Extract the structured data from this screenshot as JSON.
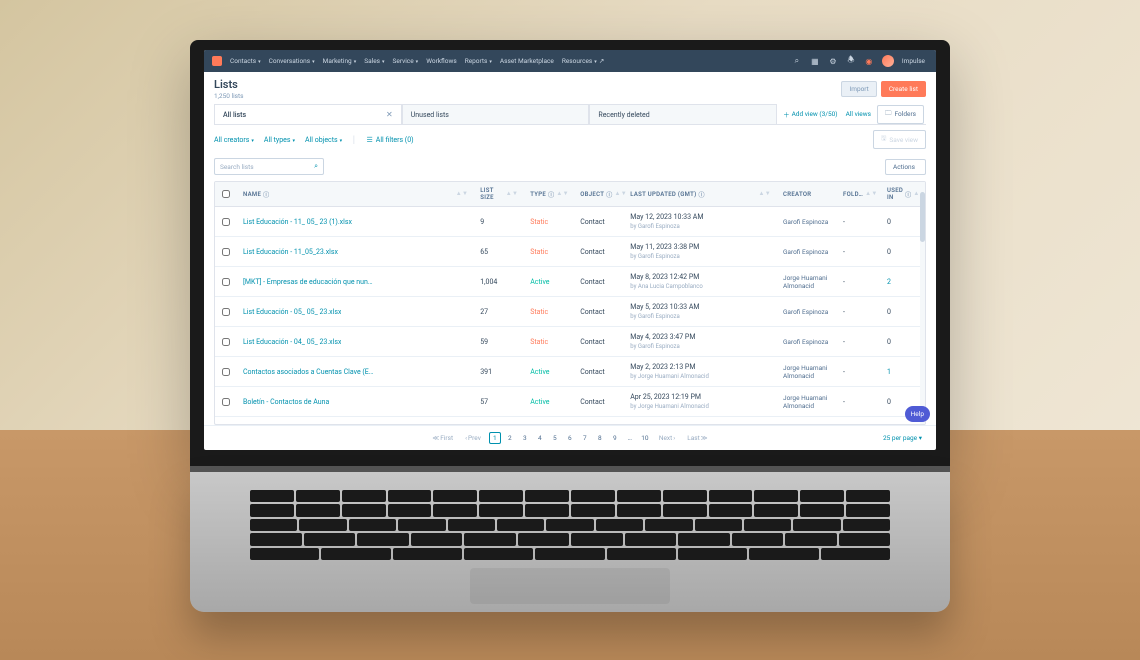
{
  "nav": {
    "items": [
      "Contacts",
      "Conversations",
      "Marketing",
      "Sales",
      "Service",
      "Workflows",
      "Reports",
      "Asset Marketplace",
      "Resources"
    ],
    "account": "Impulse"
  },
  "header": {
    "title": "Lists",
    "subtitle": "1,250 lists",
    "import_btn": "Import",
    "create_btn": "Create list"
  },
  "tabs": {
    "items": [
      "All lists",
      "Unused lists",
      "Recently deleted"
    ],
    "add_view": "Add view (3/50)",
    "all_views": "All views",
    "folders": "Folders"
  },
  "filters": {
    "creators": "All creators",
    "types": "All types",
    "objects": "All objects",
    "all_filters": "All filters (0)",
    "save_view": "Save view"
  },
  "search": {
    "placeholder": "Search lists",
    "actions": "Actions"
  },
  "columns": {
    "name": "NAME",
    "size": "LIST SIZE",
    "type": "TYPE",
    "object": "OBJECT",
    "updated": "LAST UPDATED (GMT)",
    "creator": "CREATOR",
    "folder": "FOLD…",
    "usedin": "USED IN"
  },
  "rows": [
    {
      "name": "List Educación - 11_ 05_ 23 (1).xlsx",
      "size": "9",
      "type": "Static",
      "type_kind": "static",
      "object": "Contact",
      "updated": "May 12, 2023 10:33 AM",
      "by": "by Garofi Espinoza",
      "creator": "Garofi Espinoza",
      "folder": "-",
      "usedin": "0",
      "usedin_link": false
    },
    {
      "name": "List Educación - 11_05_23.xlsx",
      "size": "65",
      "type": "Static",
      "type_kind": "static",
      "object": "Contact",
      "updated": "May 11, 2023 3:38 PM",
      "by": "by Garofi Espinoza",
      "creator": "Garofi Espinoza",
      "folder": "-",
      "usedin": "0",
      "usedin_link": false
    },
    {
      "name": "[MKT] - Empresas de educación que nun…",
      "size": "1,004",
      "type": "Active",
      "type_kind": "active",
      "object": "Contact",
      "updated": "May 8, 2023 12:42 PM",
      "by": "by Ana Lucia Campoblanco",
      "creator": "Jorge Huamani Almonacid",
      "folder": "-",
      "usedin": "2",
      "usedin_link": true
    },
    {
      "name": "List Educación - 05_ 05_ 23.xlsx",
      "size": "27",
      "type": "Static",
      "type_kind": "static",
      "object": "Contact",
      "updated": "May 5, 2023 10:33 AM",
      "by": "by Garofi Espinoza",
      "creator": "Garofi Espinoza",
      "folder": "-",
      "usedin": "0",
      "usedin_link": false
    },
    {
      "name": "List Educación - 04_ 05_ 23.xlsx",
      "size": "59",
      "type": "Static",
      "type_kind": "static",
      "object": "Contact",
      "updated": "May 4, 2023 3:47 PM",
      "by": "by Garofi Espinoza",
      "creator": "Garofi Espinoza",
      "folder": "-",
      "usedin": "0",
      "usedin_link": false
    },
    {
      "name": "Contactos asociados a Cuentas Clave (E…",
      "size": "391",
      "type": "Active",
      "type_kind": "active",
      "object": "Contact",
      "updated": "May 2, 2023 2:13 PM",
      "by": "by Jorge Huamani Almonacid",
      "creator": "Jorge Huamani Almonacid",
      "folder": "-",
      "usedin": "1",
      "usedin_link": true
    },
    {
      "name": "Boletín - Contactos de Auna",
      "size": "57",
      "type": "Active",
      "type_kind": "active",
      "object": "Contact",
      "updated": "Apr 25, 2023 12:19 PM",
      "by": "by Jorge Huamani Almonacid",
      "creator": "Jorge Huamani Almonacid",
      "folder": "-",
      "usedin": "0",
      "usedin_link": false
    }
  ],
  "pager": {
    "first": "First",
    "prev": "Prev",
    "next": "Next",
    "last": "Last",
    "pages": [
      "1",
      "2",
      "3",
      "4",
      "5",
      "6",
      "7",
      "8",
      "9",
      "…",
      "10"
    ],
    "per_page": "25 per page"
  },
  "help": "Help"
}
